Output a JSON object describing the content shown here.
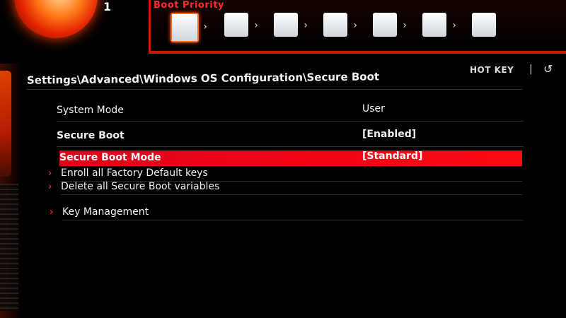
{
  "dial": {
    "badge": "1"
  },
  "boot_priority": {
    "title": "Boot Priority",
    "devices": [
      "",
      "",
      "",
      "",
      "",
      "",
      ""
    ]
  },
  "header": {
    "breadcrumb": "Settings\\Advanced\\Windows OS Configuration\\Secure Boot",
    "hotkey_label": "HOT KEY",
    "separator": "|",
    "back_symbol": "↺"
  },
  "settings": [
    {
      "label": "System Mode",
      "value": "User"
    },
    {
      "label": "Secure Boot",
      "value": "[Enabled]"
    },
    {
      "label": "Secure Boot Mode",
      "value": "[Standard]"
    }
  ],
  "submenus": [
    {
      "label": "Enroll all Factory Default keys"
    },
    {
      "label": "Delete all Secure Boot variables"
    },
    {
      "label": "Key Management"
    }
  ],
  "colors": {
    "accent": "#e0001a",
    "background": "#000000",
    "arrow": "#ff1a1a"
  }
}
